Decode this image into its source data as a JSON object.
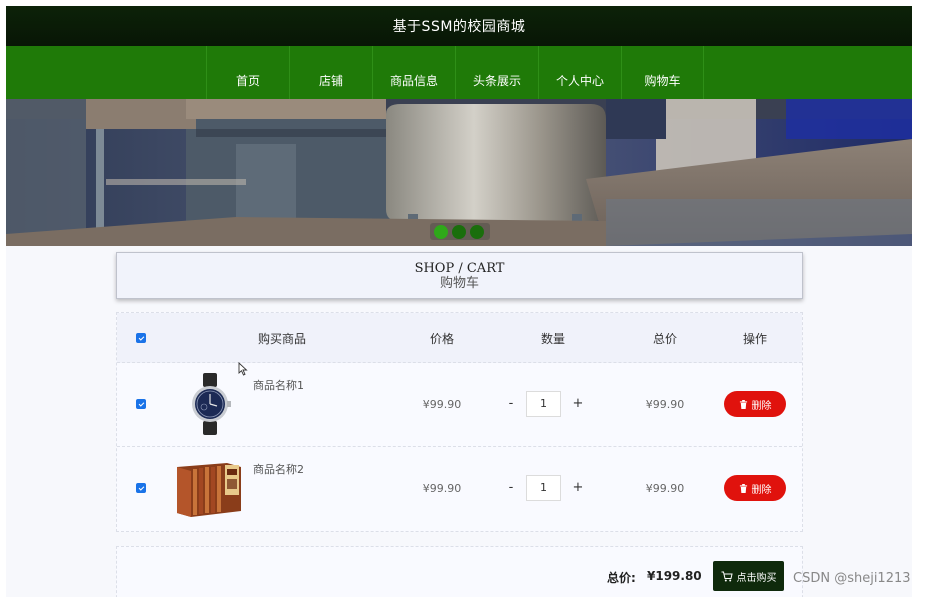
{
  "site": {
    "title": "基于SSM的校园商城"
  },
  "nav": {
    "items": [
      "首页",
      "店铺",
      "商品信息",
      "头条展示",
      "个人中心",
      "购物车"
    ]
  },
  "banner": {
    "slides": 3,
    "active_slide": 1
  },
  "section": {
    "title_en": "SHOP / CART",
    "title_cn": "购物车"
  },
  "cart": {
    "all_selected": true,
    "columns": {
      "product": "购买商品",
      "price": "价格",
      "quantity": "数量",
      "total": "总价",
      "action": "操作"
    },
    "qty_minus": "-",
    "qty_plus": "+",
    "delete_label": "删除",
    "items": [
      {
        "name": "商品名称1",
        "price": "¥99.90",
        "quantity": "1",
        "total": "¥99.90",
        "checked": true,
        "image": "watch-image"
      },
      {
        "name": "商品名称2",
        "price": "¥99.90",
        "quantity": "1",
        "total": "¥99.90",
        "checked": true,
        "image": "book-set-image"
      }
    ],
    "sum_label": "总价:",
    "sum_value": "¥199.80",
    "buy_label": "点击购买"
  },
  "colors": {
    "nav_green": "#1f7a08",
    "header_dark": "#0c2208",
    "delete_red": "#e0120d",
    "buy_dark": "#0f2a0c",
    "checkbox_blue": "#1a73e8"
  },
  "watermark": "CSDN @sheji1213"
}
